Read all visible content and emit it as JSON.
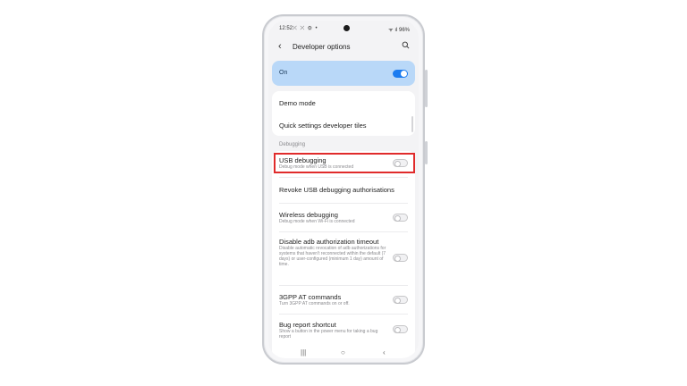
{
  "status_bar": {
    "time": "12:52",
    "left_icons": "⤫ ⤫ ⚙ •",
    "right_icons": "ᯤ ıl 96%"
  },
  "header": {
    "back_glyph": "‹",
    "title": "Developer options"
  },
  "master_switch": {
    "label": "On",
    "state": "on"
  },
  "top_items": [
    {
      "label": "Demo mode"
    },
    {
      "label": "Quick settings developer tiles"
    }
  ],
  "section_label": "Debugging",
  "debug_items": [
    {
      "label": "USB debugging",
      "description": "Debug mode when USB is connected",
      "toggle": "off"
    },
    {
      "label": "Revoke USB debugging authorisations",
      "description": "",
      "toggle": "none"
    },
    {
      "label": "Wireless debugging",
      "description": "Debug mode when Wi-Fi is connected",
      "toggle": "off"
    },
    {
      "label": "Disable adb authorization timeout",
      "description": "Disable automatic revocation of adb authorizations for systems that haven't reconnected within the default (7 days) or user-configured (minimum 1 day) amount of time.",
      "toggle": "off"
    },
    {
      "label": "3GPP AT commands",
      "description": "Turn 3GPP AT commands on or off.",
      "toggle": "off"
    },
    {
      "label": "Bug report shortcut",
      "description": "Show a button in the power menu for taking a bug report",
      "toggle": "off"
    }
  ],
  "navbar": {
    "recents": "|||",
    "home": "○",
    "back": "‹"
  },
  "colors": {
    "accent": "#1c7cf0",
    "master_card": "#b9d8f8",
    "highlight": "#e02b2b"
  }
}
